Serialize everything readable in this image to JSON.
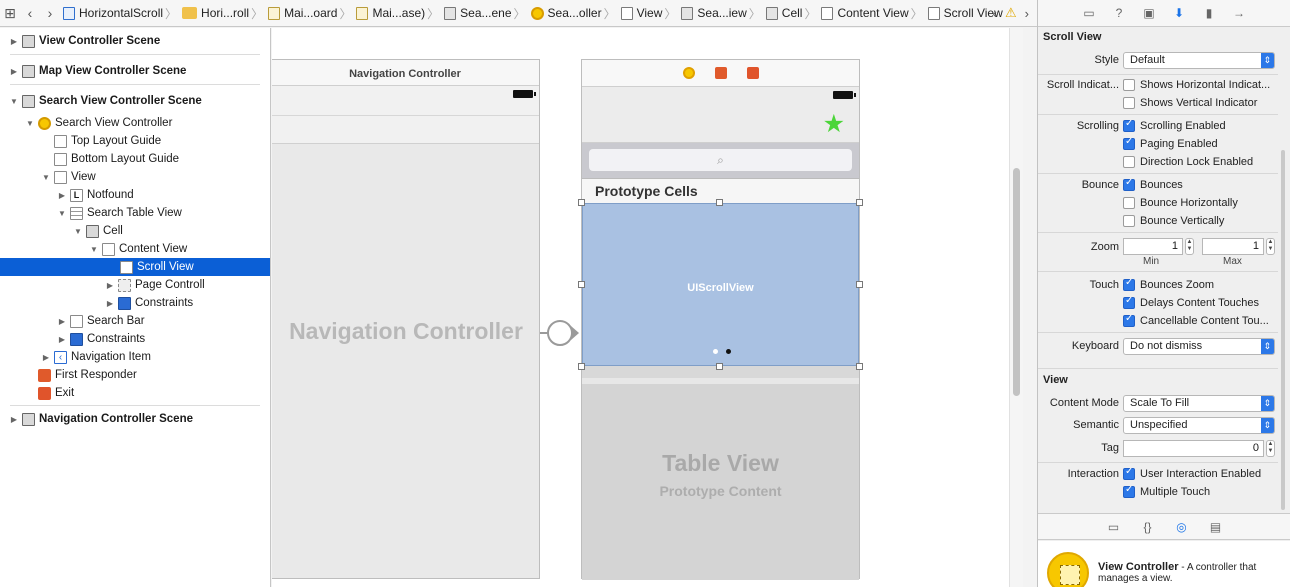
{
  "jumpbar": {
    "crumbs": [
      {
        "label": "HorizontalScroll",
        "icon": "project-file-icon"
      },
      {
        "label": "Hori...roll",
        "icon": "folder-icon"
      },
      {
        "label": "Mai...oard",
        "icon": "storyboard-file-icon"
      },
      {
        "label": "Mai...ase)",
        "icon": "storyboard-file-icon"
      },
      {
        "label": "Sea...ene",
        "icon": "scene-icon"
      },
      {
        "label": "Sea...oller",
        "icon": "view-controller-icon"
      },
      {
        "label": "View",
        "icon": "view-icon"
      },
      {
        "label": "Sea...iew",
        "icon": "table-view-icon"
      },
      {
        "label": "Cell",
        "icon": "cell-icon"
      },
      {
        "label": "Content View",
        "icon": "view-icon"
      },
      {
        "label": "Scroll View",
        "icon": "view-icon"
      }
    ]
  },
  "outline": {
    "rows": [
      {
        "label": "View Controller Scene"
      },
      {
        "label": "Map View Controller Scene"
      },
      {
        "label": "Search View Controller Scene"
      },
      {
        "label": "Search View Controller"
      },
      {
        "label": "Top Layout Guide"
      },
      {
        "label": "Bottom Layout Guide"
      },
      {
        "label": "View"
      },
      {
        "label": "Notfound"
      },
      {
        "label": "Search Table View"
      },
      {
        "label": "Cell"
      },
      {
        "label": "Content View"
      },
      {
        "label": "Scroll View"
      },
      {
        "label": "Page Controll"
      },
      {
        "label": "Constraints"
      },
      {
        "label": "Search Bar"
      },
      {
        "label": "Constraints"
      },
      {
        "label": "Navigation Item"
      },
      {
        "label": "First Responder"
      },
      {
        "label": "Exit"
      },
      {
        "label": "Navigation Controller Scene"
      }
    ]
  },
  "canvas": {
    "nav_scene_title": "Navigation Controller",
    "nav_big_label": "Navigation Controller",
    "prototype_cells_header": "Prototype Cells",
    "scroll_view_label": "UIScrollView",
    "table_view_label": "Table View",
    "prototype_content_label": "Prototype Content",
    "page_control": {
      "pages": 2,
      "current": 2
    },
    "colors": {
      "scroll_view": "#a9c1e2",
      "star": "#4cd53a",
      "selection": "#0b5fd6"
    }
  },
  "inspector": {
    "scroll_view_title": "Scroll View",
    "style_label": "Style",
    "style_value": "Default",
    "scroll_indicators_label": "Scroll Indicat...",
    "shows_horizontal": {
      "label": "Shows Horizontal Indicat...",
      "checked": false
    },
    "shows_vertical": {
      "label": "Shows Vertical Indicator",
      "checked": false
    },
    "scrolling_label": "Scrolling",
    "scrolling_enabled": {
      "label": "Scrolling Enabled",
      "checked": true
    },
    "paging_enabled": {
      "label": "Paging Enabled",
      "checked": true
    },
    "direction_lock": {
      "label": "Direction Lock Enabled",
      "checked": false
    },
    "bounce_label": "Bounce",
    "bounces": {
      "label": "Bounces",
      "checked": true
    },
    "bounce_horizontally": {
      "label": "Bounce Horizontally",
      "checked": false
    },
    "bounce_vertically": {
      "label": "Bounce Vertically",
      "checked": false
    },
    "zoom_label": "Zoom",
    "zoom_min": "1",
    "zoom_max": "1",
    "min_label": "Min",
    "max_label": "Max",
    "touch_label": "Touch",
    "bounces_zoom": {
      "label": "Bounces Zoom",
      "checked": true
    },
    "delays_content_touches": {
      "label": "Delays Content Touches",
      "checked": true
    },
    "cancellable_content_touches": {
      "label": "Cancellable Content Tou...",
      "checked": true
    },
    "keyboard_label": "Keyboard",
    "keyboard_value": "Do not dismiss",
    "view_title": "View",
    "content_mode_label": "Content Mode",
    "content_mode_value": "Scale To Fill",
    "semantic_label": "Semantic",
    "semantic_value": "Unspecified",
    "tag_label": "Tag",
    "tag_value": "0",
    "interaction_label": "Interaction",
    "user_interaction_enabled": {
      "label": "User Interaction Enabled",
      "checked": true
    },
    "multiple_touch": {
      "label": "Multiple Touch",
      "checked": true
    }
  },
  "library": {
    "item_title": "View Controller",
    "item_desc": " - A controller that manages a view."
  }
}
